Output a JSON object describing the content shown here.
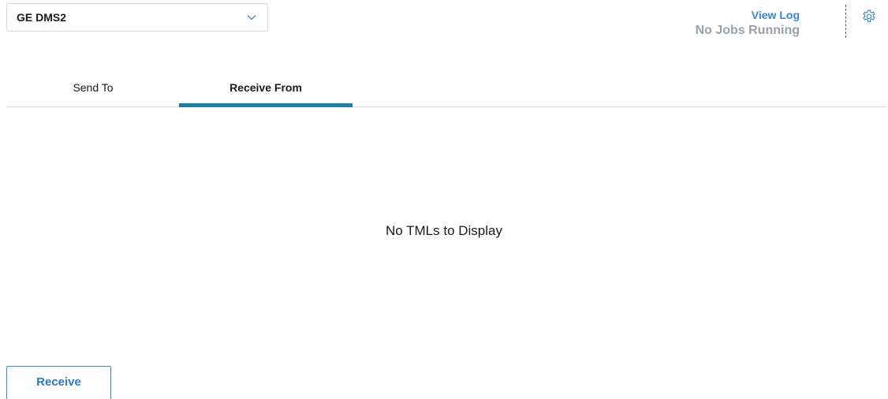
{
  "device_selector": {
    "selected_value": "GE DMS2",
    "icon": "chevron-down-icon"
  },
  "jobs": {
    "view_log_label": "View Log",
    "status_text": "No Jobs Running"
  },
  "settings": {
    "icon": "gear-icon"
  },
  "tabs": [
    {
      "label": "Send To",
      "active": false
    },
    {
      "label": "Receive From",
      "active": true
    }
  ],
  "main": {
    "empty_message": "No TMLs to Display"
  },
  "actions": {
    "receive_label": "Receive"
  },
  "colors": {
    "accent_link": "#3b86c8",
    "active_tab_underline": "#1a7fa6",
    "muted_text": "#9aa0a6",
    "border": "#d5d7da"
  }
}
